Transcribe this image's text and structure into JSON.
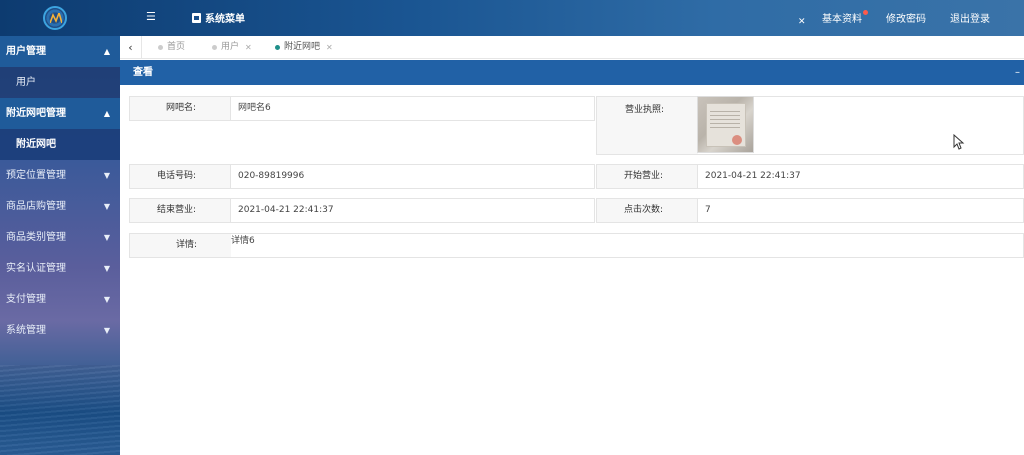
{
  "header": {
    "menu_title": "系统菜单",
    "links": [
      "基本资料",
      "修改密码",
      "退出登录"
    ],
    "colors": {
      "header_bg": "#1a5592",
      "notify_dot": "#ff5a4a"
    },
    "icons": [
      "logo-icon",
      "hamburger-icon",
      "fullscreen-icon"
    ]
  },
  "sidebar": {
    "groups": [
      {
        "label": "用户管理",
        "open": true,
        "items": [
          {
            "label": "用户",
            "active": false
          }
        ]
      },
      {
        "label": "附近网吧管理",
        "open": true,
        "items": [
          {
            "label": "附近网吧",
            "active": true
          }
        ]
      },
      {
        "label": "预定位置管理",
        "open": false,
        "items": []
      },
      {
        "label": "商品店购管理",
        "open": false,
        "items": []
      },
      {
        "label": "商品类别管理",
        "open": false,
        "items": []
      },
      {
        "label": "实名认证管理",
        "open": false,
        "items": []
      },
      {
        "label": "支付管理",
        "open": false,
        "items": []
      },
      {
        "label": "系统管理",
        "open": false,
        "items": []
      }
    ]
  },
  "tabs": [
    {
      "label": "首页",
      "closable": false,
      "active": false
    },
    {
      "label": "用户",
      "closable": true,
      "active": false
    },
    {
      "label": "附近网吧",
      "closable": true,
      "active": true
    }
  ],
  "panel": {
    "title": "查看"
  },
  "detail": {
    "name_label": "网吧名:",
    "name_value": "网吧名6",
    "license_label": "营业执照:",
    "phone_label": "电话号码:",
    "phone_value": "020-89819996",
    "open_label": "开始营业:",
    "open_value": "2021-04-21 22:41:37",
    "close_label": "结束营业:",
    "close_value": "2021-04-21 22:41:37",
    "clicks_label": "点击次数:",
    "clicks_value": "7",
    "info_label": "详情:",
    "info_value": "详情6"
  }
}
